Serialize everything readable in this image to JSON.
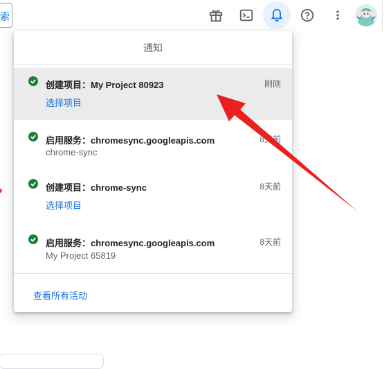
{
  "topbar": {
    "search_fragment": "索",
    "icons": [
      "gift-icon",
      "terminal-icon",
      "bell-icon",
      "help-icon",
      "more-vert-icon",
      "avatar"
    ]
  },
  "notifications": {
    "header": "通知",
    "items": [
      {
        "title": "创建项目：My Project 80923",
        "time": "刚刚",
        "action": "选择项目"
      },
      {
        "title": "启用服务：chromesync.googleapis.com",
        "time": "8天前",
        "detail": "chrome-sync"
      },
      {
        "title": "创建项目：chrome-sync",
        "time": "8天前",
        "action": "选择项目"
      },
      {
        "title": "启用服务：chromesync.googleapis.com",
        "time": "8天前",
        "detail": "My Project 65819"
      }
    ],
    "view_all": "查看所有活动"
  },
  "colors": {
    "accent": "#1a73e8",
    "success": "#188038",
    "annotation": "#ea2020",
    "highlight": "#ebebeb"
  }
}
